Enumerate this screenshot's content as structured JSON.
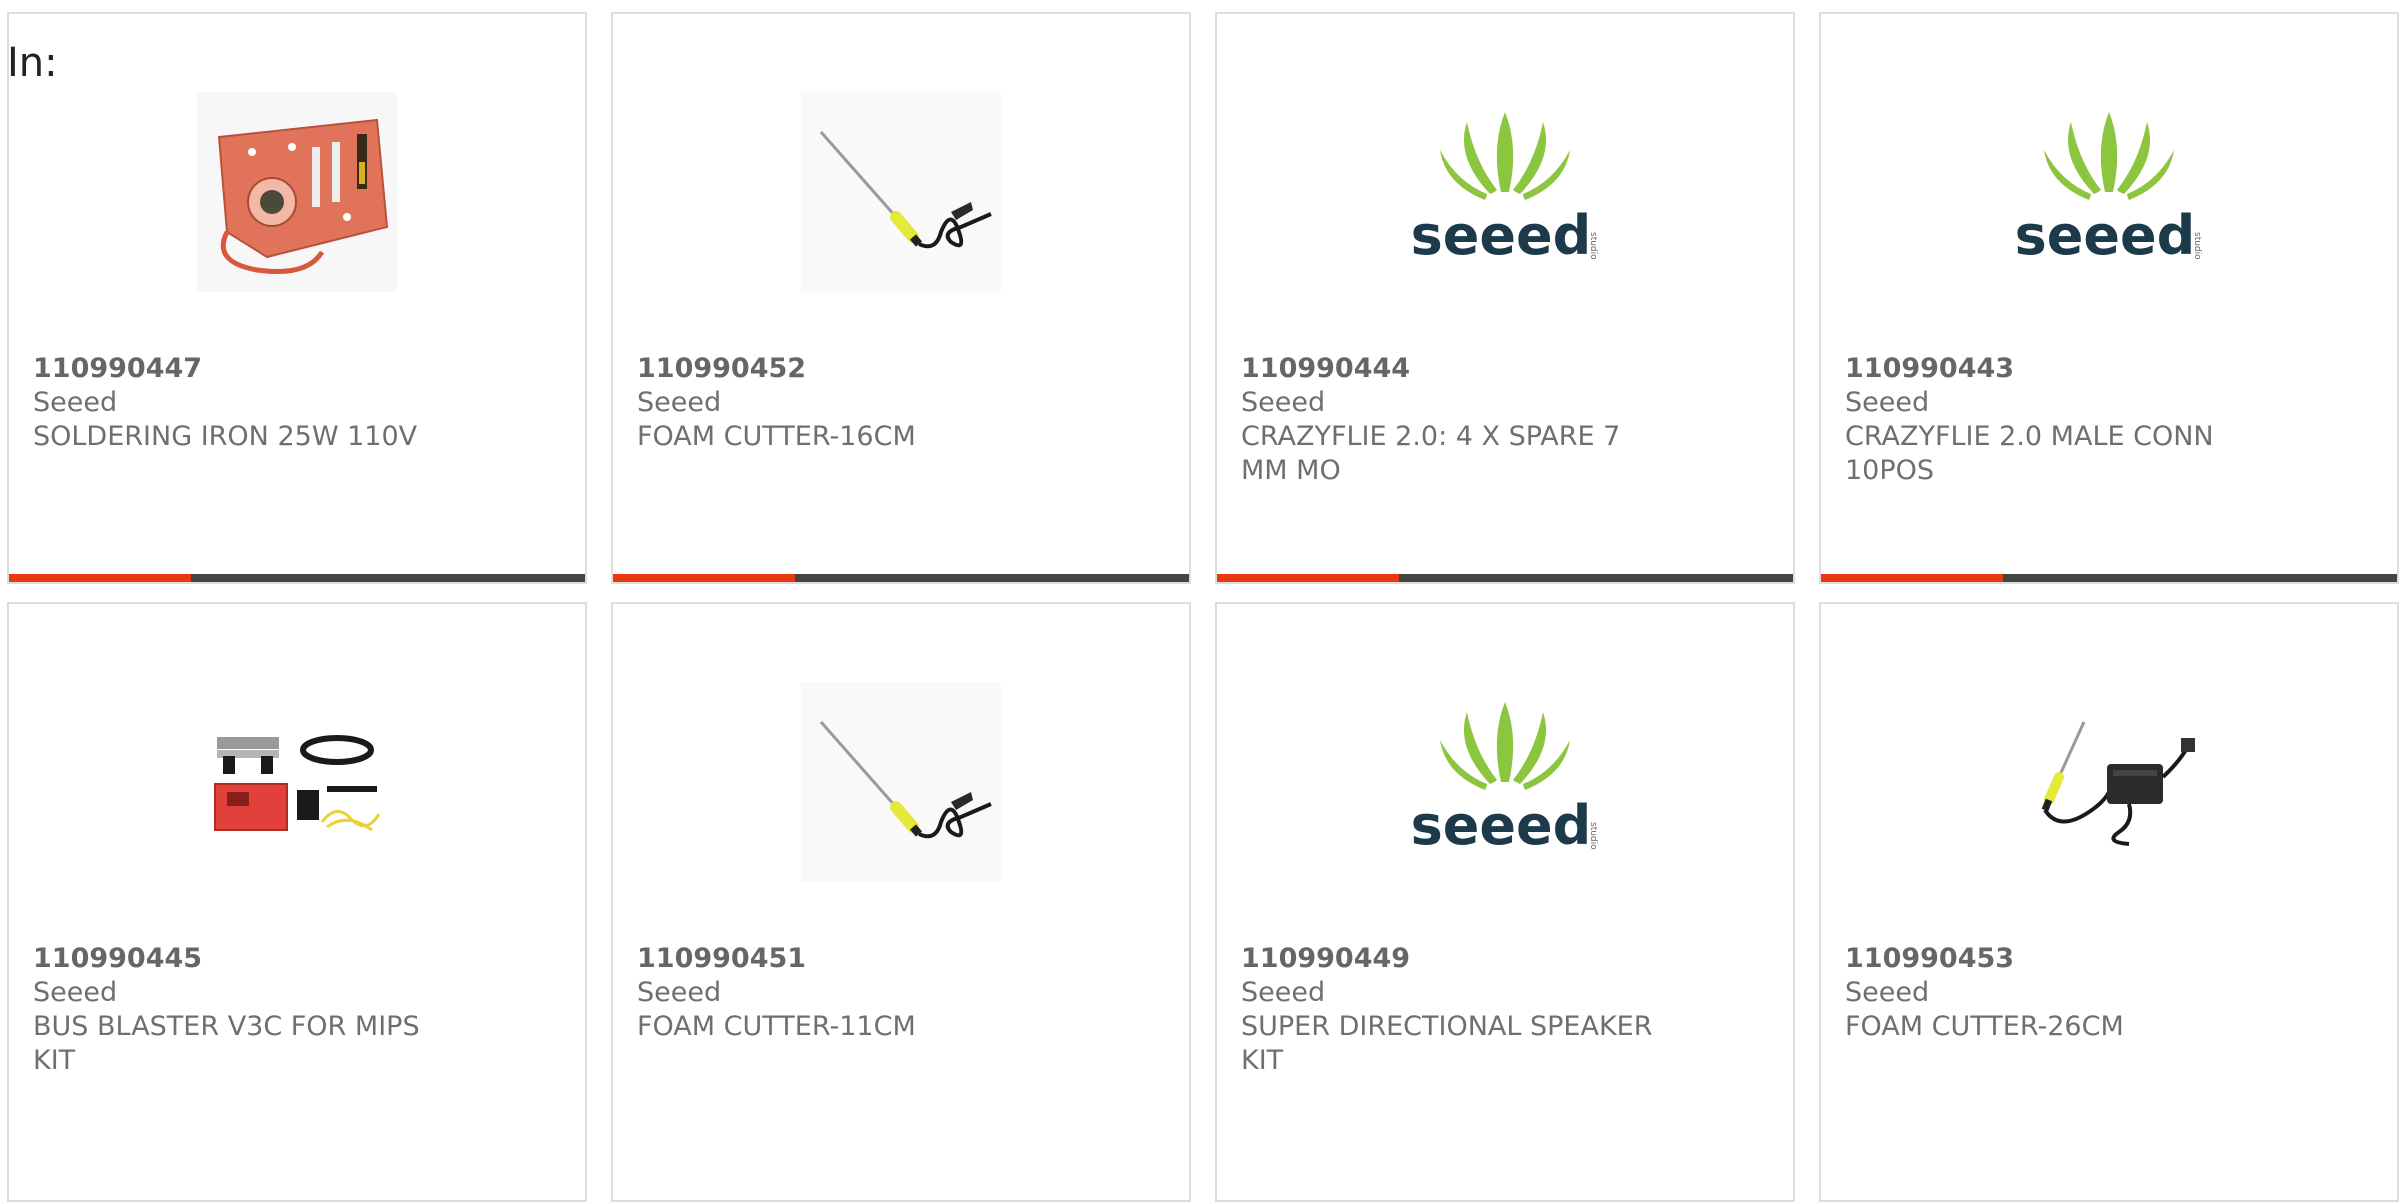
{
  "filter": {
    "label": "In:"
  },
  "colors": {
    "accent": "#e8380d",
    "bar": "#454545",
    "seeed_green": "#8cc63f",
    "seeed_navy": "#1c3a4a"
  },
  "products": [
    {
      "part_number": "110990447",
      "brand": "Seeed",
      "description": "SOLDERING IRON 25W 110V",
      "image": "soldering-iron-kit-image",
      "has_bar": true
    },
    {
      "part_number": "110990452",
      "brand": "Seeed",
      "description": "FOAM CUTTER-16CM",
      "image": "foam-cutter-image",
      "has_bar": true
    },
    {
      "part_number": "110990444",
      "brand": "Seeed",
      "description": "CRAZYFLIE 2.0: 4 X SPARE 7 MM MO",
      "image": "seeed-logo",
      "has_bar": true
    },
    {
      "part_number": "110990443",
      "brand": "Seeed",
      "description": "CRAZYFLIE 2.0 MALE CONN 10POS",
      "image": "seeed-logo",
      "has_bar": true
    },
    {
      "part_number": "110990445",
      "brand": "Seeed",
      "description": "BUS BLASTER V3C FOR MIPS KIT",
      "image": "bus-blaster-kit-image",
      "has_bar": false
    },
    {
      "part_number": "110990451",
      "brand": "Seeed",
      "description": "FOAM CUTTER-11CM",
      "image": "foam-cutter-image",
      "has_bar": false
    },
    {
      "part_number": "110990449",
      "brand": "Seeed",
      "description": "SUPER DIRECTIONAL SPEAKER KIT",
      "image": "seeed-logo",
      "has_bar": false
    },
    {
      "part_number": "110990453",
      "brand": "Seeed",
      "description": "FOAM CUTTER-26CM",
      "image": "foam-cutter-adapter-image",
      "has_bar": false
    }
  ]
}
